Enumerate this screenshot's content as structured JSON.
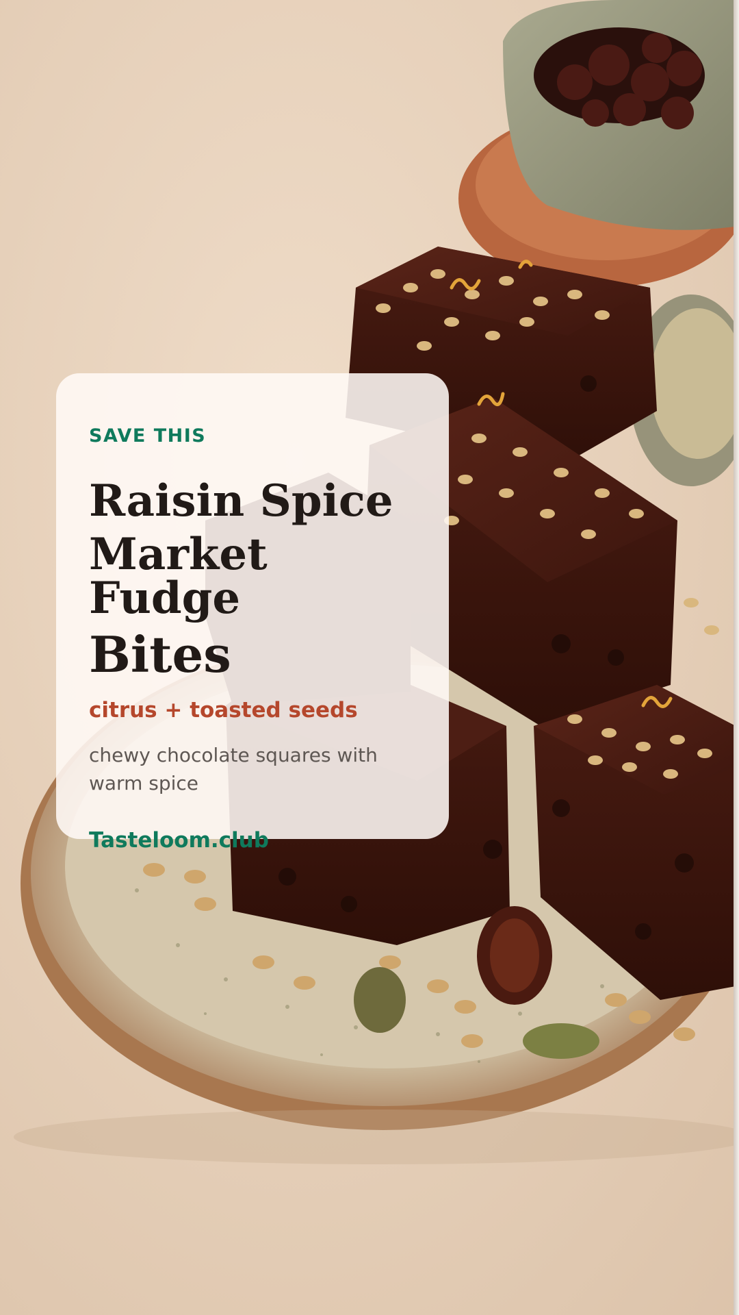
{
  "pin": {
    "eyebrow": "SAVE THIS",
    "title_lines": [
      "Raisin Spice",
      "Market Fudge",
      "Bites"
    ],
    "tagline": "citrus + toasted seeds",
    "description": "chewy chocolate squares with warm spice",
    "site": "Tasteloom.club"
  },
  "colors": {
    "accent_green": "#0f7a5c",
    "accent_rust": "#b5472c",
    "background": "#e7d3bf"
  },
  "photo": {
    "subject": "chocolate-fudge-squares-on-speckled-plate-icon"
  }
}
